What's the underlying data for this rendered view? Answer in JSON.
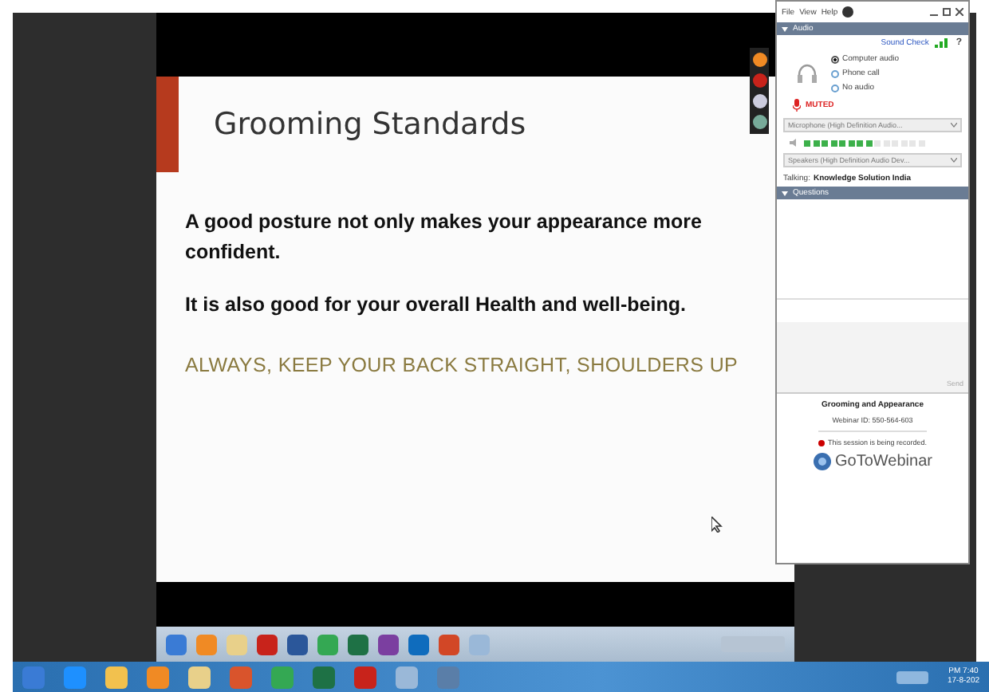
{
  "slide": {
    "title": "Grooming Standards",
    "paragraphs": [
      "A good posture not only makes your appearance more confident.",
      "It is also good for your overall Health and well-being."
    ],
    "motto": "ALWAYS, KEEP YOUR BACK STRAIGHT, SHOULDERS UP"
  },
  "panel": {
    "menu": [
      "File",
      "View",
      "Help"
    ],
    "audio": {
      "header": "Audio",
      "sound_check": "Sound Check",
      "help": "?",
      "options": [
        {
          "label": "Computer audio",
          "selected": true
        },
        {
          "label": "Phone call",
          "selected": false
        },
        {
          "label": "No audio",
          "selected": false
        }
      ],
      "muted_label": "MUTED",
      "microphone": "Microphone (High Definition Audio...",
      "speaker_meter": {
        "level": 0.57
      },
      "speakers": "Speakers (High Definition Audio Dev...",
      "talking_label": "Talking:",
      "talking_name": "Knowledge Solution India"
    },
    "questions": {
      "header": "Questions",
      "send": "Send"
    },
    "webinar_title": "Grooming and Appearance",
    "webinar_id": "Webinar ID: 550-564-603",
    "recording_notice": "This session is being recorded.",
    "logo": "**GoTo**Webinar"
  },
  "taskbar": {
    "time": "PM 7:40",
    "date": "17-8-202"
  }
}
